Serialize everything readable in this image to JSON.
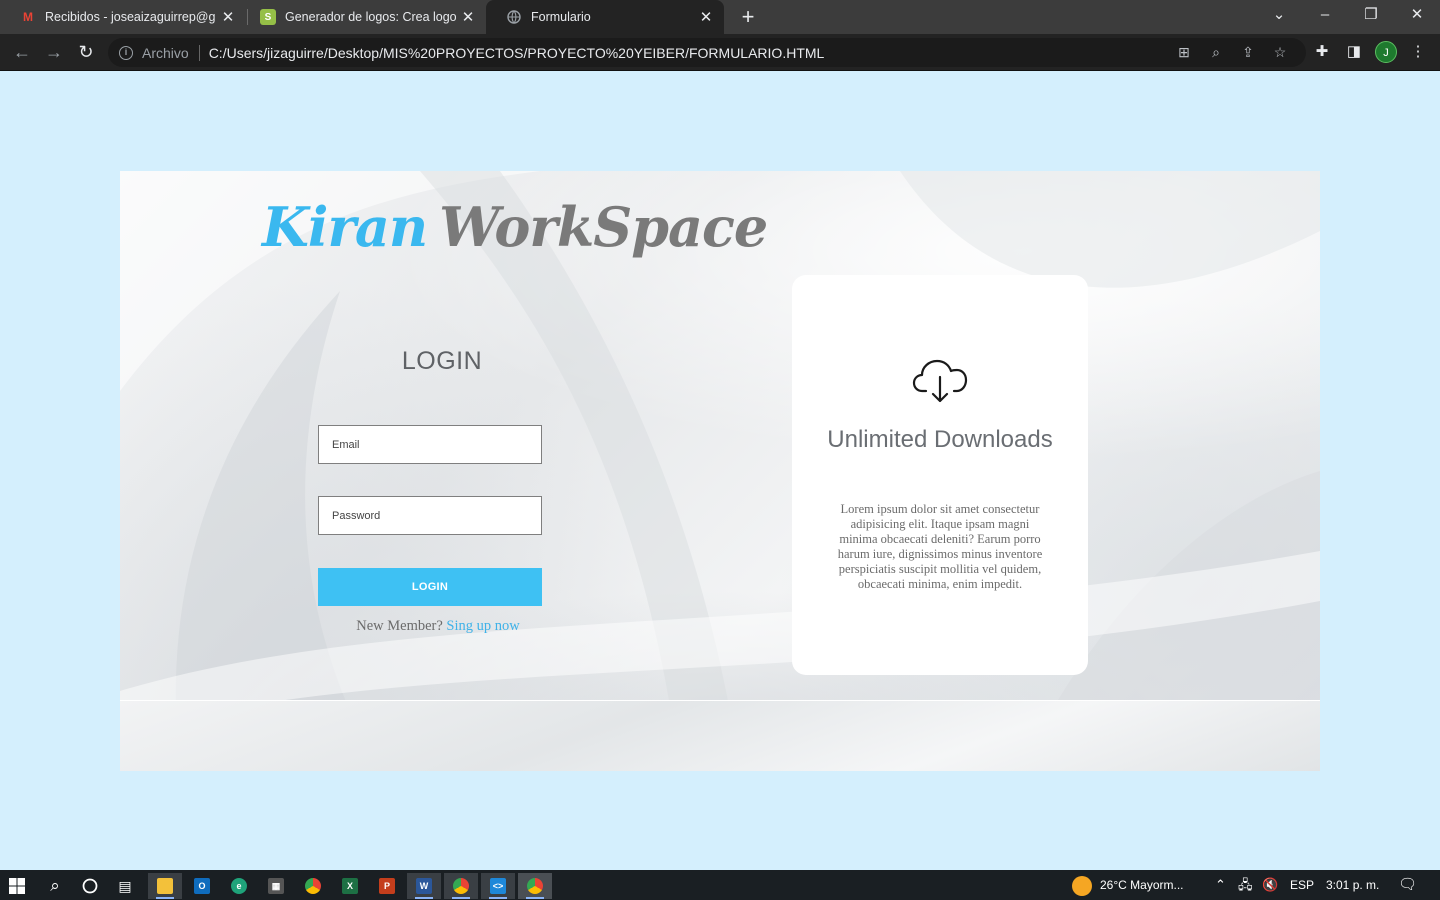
{
  "browser": {
    "tabs": [
      {
        "title": "Recibidos - joseaizaguirrep@gmail.com",
        "icon": "gmail-icon",
        "active": false
      },
      {
        "title": "Generador de logos: Crea logos gratis",
        "icon": "shopify-icon",
        "active": false
      },
      {
        "title": "Formulario",
        "icon": "globe-icon",
        "active": true
      }
    ],
    "omnibox": {
      "scheme_label": "Archivo",
      "url": "C:/Users/jizaguirre/Desktop/MIS%20PROYECTOS/PROYECTO%20YEIBER/FORMULARIO.HTML"
    },
    "profile_initial": "J"
  },
  "page": {
    "logo": {
      "part1": "Kiran",
      "part2": "WorkSpace"
    },
    "login": {
      "title": "LOGIN",
      "email_placeholder": "Email",
      "password_placeholder": "Password",
      "button_label": "LOGIN",
      "new_member_text": "New Member?",
      "signup_link": "Sing up now"
    },
    "feature_card": {
      "icon": "cloud-download-icon",
      "title": "Unlimited Downloads",
      "text": "Lorem ipsum dolor sit amet consectetur adipisicing elit. Itaque ipsam magni minima obcaecati deleniti? Earum porro harum iure, dignissimos minus inventore perspiciatis suscipit mollitia vel quidem, obcaecati minima, enim impedit."
    },
    "colors": {
      "accent": "#3ec1f3",
      "page_background": "#d4effd",
      "logo_gray": "#7a7a7a"
    }
  },
  "taskbar": {
    "weather": "26°C  Mayorm...",
    "language": "ESP",
    "clock": "3:01 p. m."
  }
}
